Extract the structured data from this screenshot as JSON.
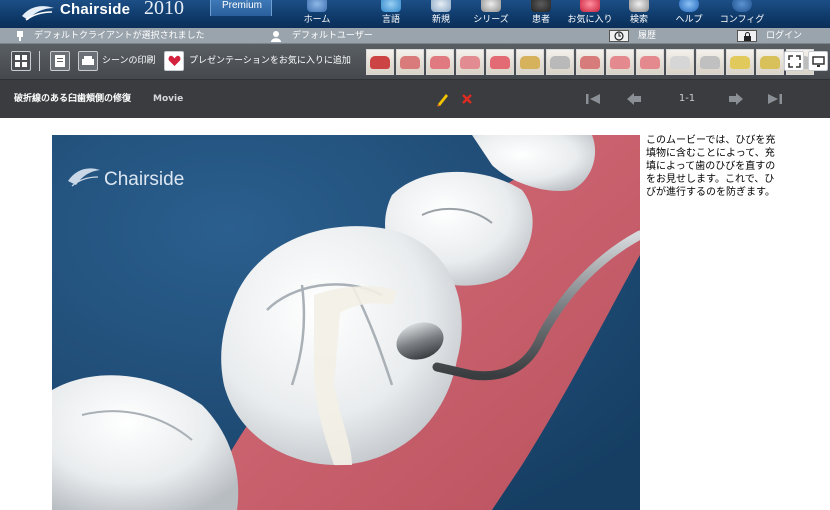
{
  "app": {
    "brand": "Chairside",
    "year": "2010",
    "edition": "Premium"
  },
  "nav": [
    {
      "label": "ホーム",
      "icon": "home-icon"
    },
    {
      "label": "言語",
      "icon": "language-icon"
    },
    {
      "label": "新規",
      "icon": "new-icon"
    },
    {
      "label": "シリーズ",
      "icon": "series-icon"
    },
    {
      "label": "患者",
      "icon": "patient-icon"
    },
    {
      "label": "お気に入り",
      "icon": "favorites-icon"
    },
    {
      "label": "検索",
      "icon": "search-icon"
    },
    {
      "label": "ヘルプ",
      "icon": "help-icon"
    },
    {
      "label": "コンフィグ",
      "icon": "config-icon"
    }
  ],
  "status": {
    "client": "デフォルトクライアントが選択されました",
    "user": "デフォルトユーザー",
    "history": "履歴",
    "login": "ログイン"
  },
  "tools": {
    "print_scene": "シーンの印刷",
    "add_favorite": "プレゼンテーションをお気に入りに追加"
  },
  "thumbnails": [
    {
      "name": "instrument",
      "color": "#c44"
    },
    {
      "name": "bridge",
      "color": "#d97b7b"
    },
    {
      "name": "gum",
      "color": "#e07a80"
    },
    {
      "name": "teeth-open",
      "color": "#e28b90"
    },
    {
      "name": "smile",
      "color": "#e36b73"
    },
    {
      "name": "roots",
      "color": "#d6b25c"
    },
    {
      "name": "crossed",
      "color": "#b9b9b9"
    },
    {
      "name": "arch",
      "color": "#d87b7b"
    },
    {
      "name": "lower-teeth",
      "color": "#e48a8f"
    },
    {
      "name": "gum-detail",
      "color": "#e48a8f"
    },
    {
      "name": "front-teeth",
      "color": "#d6d6d6"
    },
    {
      "name": "implant",
      "color": "#c0c0c0"
    },
    {
      "name": "ortho",
      "color": "#e2c95b"
    },
    {
      "name": "wire",
      "color": "#d8c05a"
    },
    {
      "name": "crown",
      "color": "#bdbdbd"
    }
  ],
  "movie": {
    "title": "破折線のある臼歯頬側の修復",
    "tag": "Movie",
    "page": "1-1",
    "watermark": "Chairside",
    "description": "このムービーでは、ひびを充填物に含むことによって、充填によって歯のひびを直すのをお見せします。これで、ひびが進行するのを防ぎます。"
  }
}
